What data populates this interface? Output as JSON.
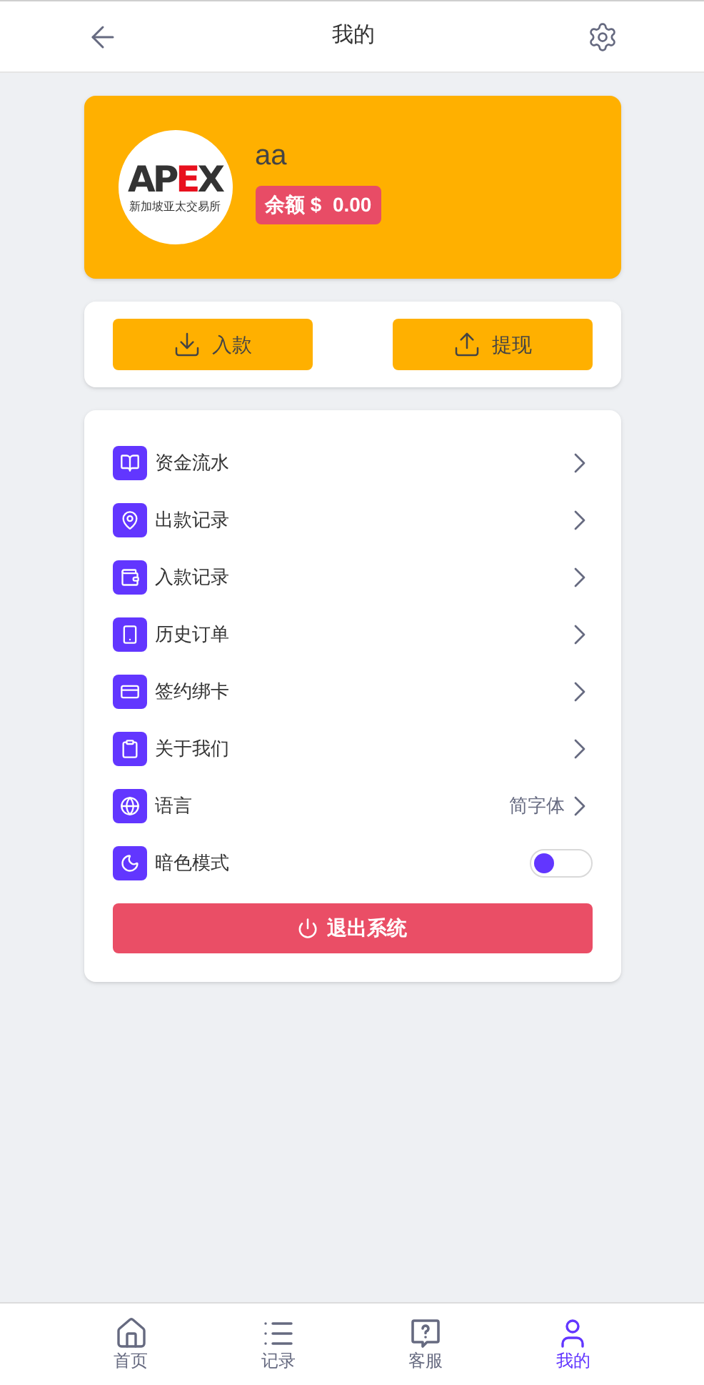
{
  "header": {
    "title": "我的"
  },
  "profile": {
    "logo": {
      "wordmark_left": "AP",
      "wordmark_accent": "E",
      "wordmark_right": "X",
      "tagline": "新加坡亚太交易所"
    },
    "name": "aa",
    "balance_label": "余额 $",
    "balance": "0.00"
  },
  "actions": [
    {
      "kind": "deposit",
      "label": "入款"
    },
    {
      "kind": "withdraw",
      "label": "提现"
    }
  ],
  "menu": [
    {
      "kind": "link",
      "label": "资金流水"
    },
    {
      "kind": "link",
      "label": "出款记录"
    },
    {
      "kind": "link",
      "label": "入款记录"
    },
    {
      "kind": "link",
      "label": "历史订单"
    },
    {
      "kind": "link",
      "label": "签约绑卡"
    },
    {
      "kind": "link",
      "label": "关于我们"
    },
    {
      "kind": "value",
      "label": "语言",
      "value": "简字体"
    },
    {
      "kind": "toggle",
      "label": "暗色模式",
      "on": false
    }
  ],
  "logout": {
    "label": "退出系统"
  },
  "tabbar": [
    {
      "label": "首页",
      "selected": false
    },
    {
      "label": "记录",
      "selected": false
    },
    {
      "label": "客服",
      "selected": false
    },
    {
      "label": "我的",
      "selected": true
    }
  ]
}
